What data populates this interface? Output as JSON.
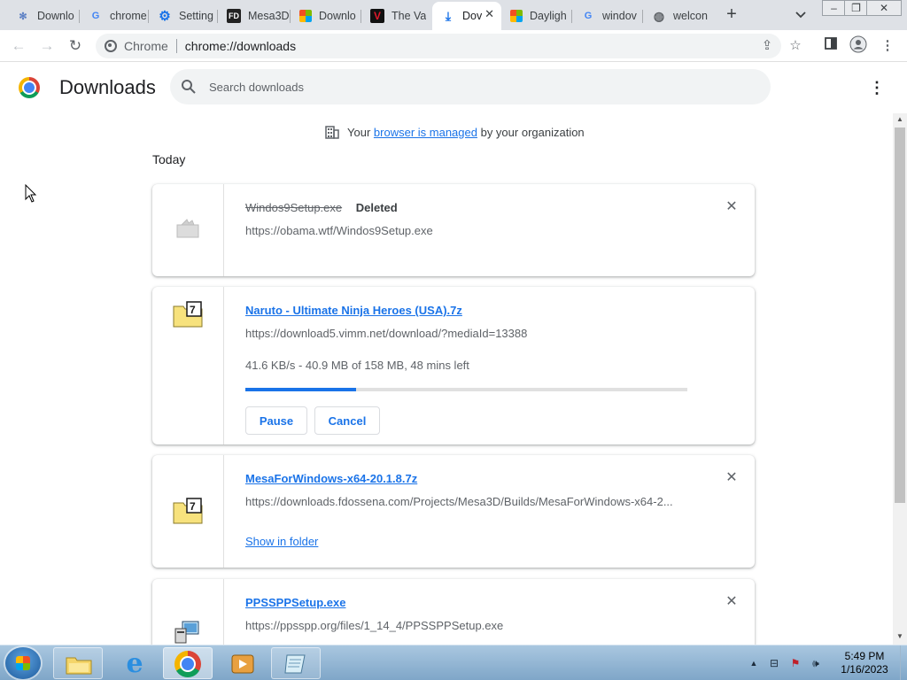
{
  "browser": {
    "tabs": [
      {
        "label": "Downlo",
        "icon": "snowflake-icon",
        "color": "#5b7fc4"
      },
      {
        "label": "chrome",
        "icon": "google-icon",
        "color": "#4285f4"
      },
      {
        "label": "Setting",
        "icon": "settings-gear-icon",
        "color": "#1a73e8"
      },
      {
        "label": "Mesa3D",
        "icon": "fd-icon",
        "color": "#222222"
      },
      {
        "label": "Downlo",
        "icon": "microsoft-icon",
        "color": "#f25022"
      },
      {
        "label": "The Va",
        "icon": "vault-icon",
        "color": "#b31217"
      },
      {
        "label": "Dov",
        "icon": "download-icon",
        "color": "#1a73e8",
        "active": true
      },
      {
        "label": "Dayligh",
        "icon": "microsoft-icon",
        "color": "#f25022"
      },
      {
        "label": "windov",
        "icon": "google-icon",
        "color": "#4285f4"
      },
      {
        "label": "welcon",
        "icon": "globe-icon",
        "color": "#5f6368"
      }
    ],
    "site_chip": "Chrome",
    "url": "chrome://downloads"
  },
  "page": {
    "title": "Downloads",
    "search_placeholder": "Search downloads",
    "managed_prefix": "Your",
    "managed_link": "browser is managed",
    "managed_suffix": "by your organization",
    "section_date": "Today"
  },
  "downloads": [
    {
      "filename": "Windos9Setup.exe",
      "status": "Deleted",
      "url": "https://obama.wtf/Windos9Setup.exe"
    },
    {
      "filename": "Naruto - Ultimate Ninja Heroes (USA).7z",
      "url": "https://download5.vimm.net/download/?mediaId=13388",
      "progress_text": "41.6 KB/s - 40.9 MB of 158 MB, 48 mins left",
      "progress_fraction": 0.25,
      "pause_label": "Pause",
      "cancel_label": "Cancel"
    },
    {
      "filename": "MesaForWindows-x64-20.1.8.7z",
      "url": "https://downloads.fdossena.com/Projects/Mesa3D/Builds/MesaForWindows-x64-2...",
      "show_in_folder": "Show in folder"
    },
    {
      "filename": "PPSSPPSetup.exe",
      "url": "https://ppsspp.org/files/1_14_4/PPSSPPSetup.exe"
    }
  ],
  "taskbar": {
    "time": "5:49 PM",
    "date": "1/16/2023",
    "pinned": [
      "file-explorer-icon",
      "internet-explorer-icon",
      "chrome-icon",
      "media-player-icon",
      "notepad-icon"
    ]
  }
}
